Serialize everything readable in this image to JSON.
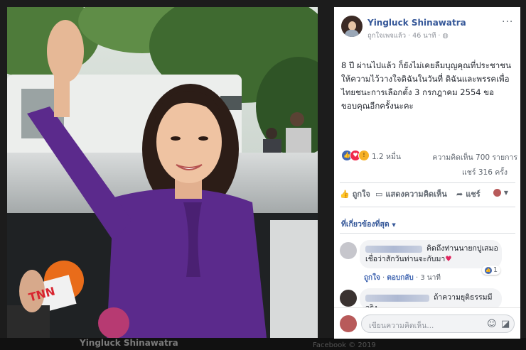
{
  "photo": {
    "tnn_logo": "TNN",
    "overlay_name": "Yingluck Shinawatra"
  },
  "post": {
    "page_name": "Yingluck Shinawatra",
    "liked_status": "ถูกใจเพจแล้ว",
    "time_ago": "46 นาที",
    "privacy_icon": "globe-icon",
    "text": "8 ปี ผ่านไปแล้ว ก็ยังไม่เคยลืมบุญคุณที่ประชาชนให้ความไว้วางใจดิฉันในวันที่ ดิฉันและพรรคเพื่อไทยชนะการเลือกตั้ง 3 กรกฎาคม 2554 ขอขอบคุณอีกครั้งนะคะ",
    "reaction_count": "1.2 หมื่น",
    "comments_count": "ความคิดเห็น 700 รายการ",
    "shares_count": "แชร์ 316 ครั้ง",
    "reaction_icons": [
      "like-icon",
      "love-icon",
      "wow-icon"
    ]
  },
  "actions": {
    "like": "ถูกใจ",
    "comment": "แสดงความคิดเห็น",
    "share": "แชร์"
  },
  "comments": {
    "sort_label": "ที่เกี่ยวข้องที่สุด",
    "items": [
      {
        "text": "คิดถึงท่านนายกปูเสมอ เชื่อว่าสักวันท่านจะกับมา",
        "heart": "♥",
        "like_label": "ถูกใจ",
        "reply_label": "ตอบกลับ",
        "time": "3 นาที",
        "like_count": "1"
      },
      {
        "text": "ถ้าความยุติธรรมมีจริง"
      }
    ]
  },
  "composer": {
    "placeholder": "เขียนความคิดเห็น..."
  },
  "footer": {
    "ghost_text": "Facebook © 2019"
  },
  "colors": {
    "link_blue": "#365899",
    "like_blue": "#4267b2",
    "love_red": "#f0284a",
    "wow_yellow": "#f7b125",
    "dress_purple": "#5b2a8c"
  }
}
